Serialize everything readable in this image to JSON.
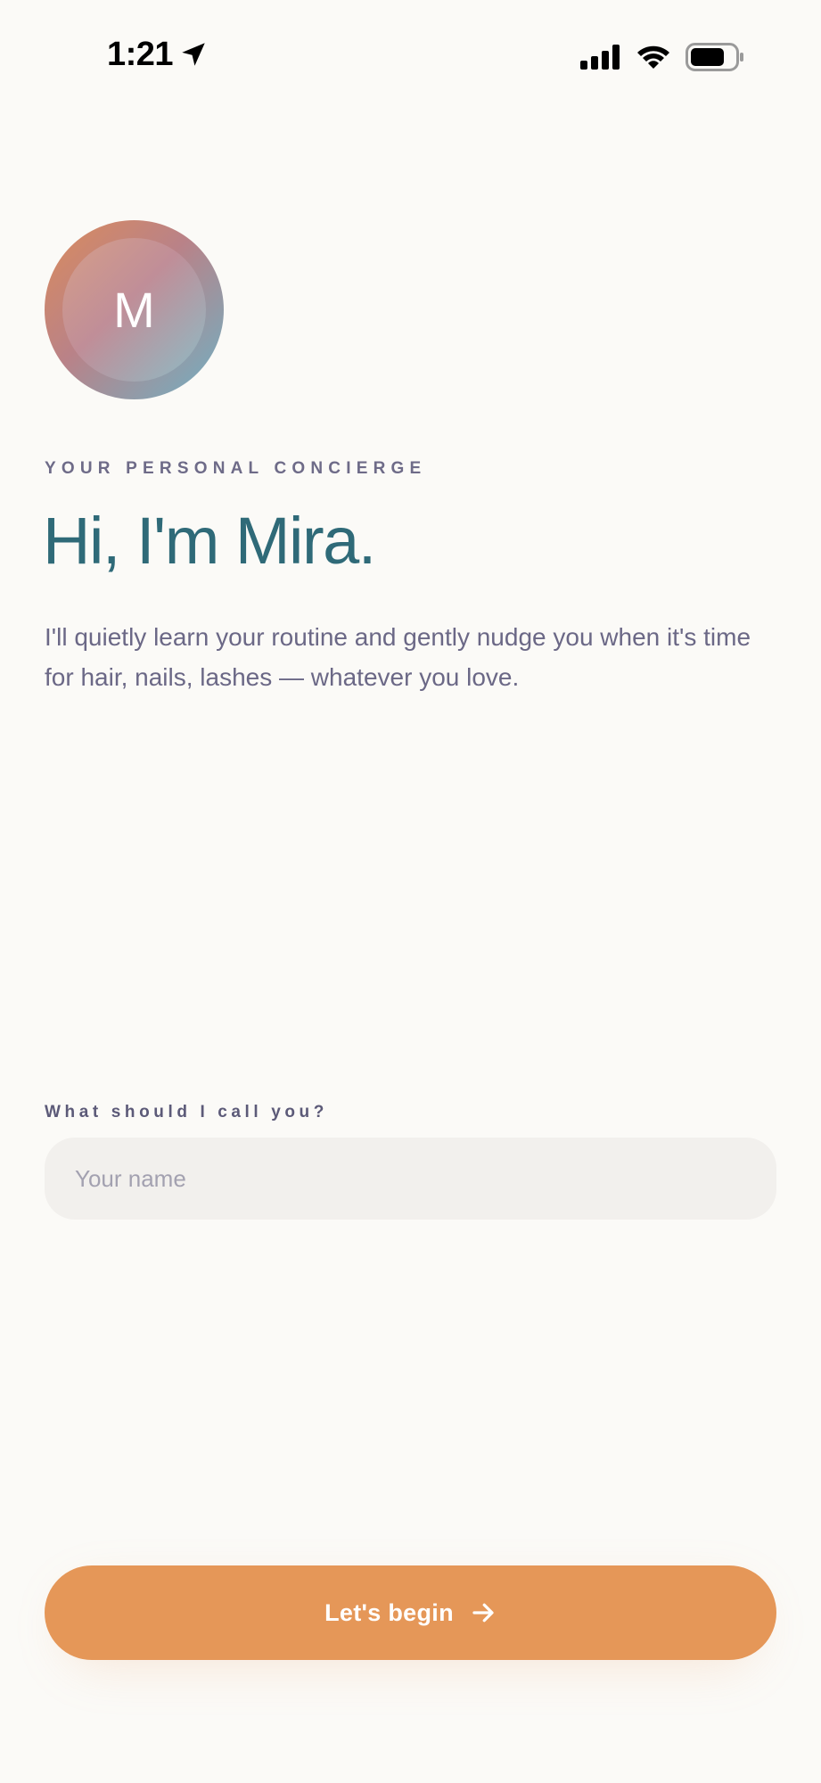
{
  "status_bar": {
    "time": "1:21",
    "icons": [
      "location-arrow-icon",
      "cellular-signal-icon",
      "wifi-icon",
      "battery-icon"
    ]
  },
  "avatar": {
    "initial": "M",
    "gradient_colors": [
      "#db8b5c",
      "#b98288",
      "#6fb1c4"
    ]
  },
  "intro": {
    "eyebrow": "YOUR PERSONAL CONCIERGE",
    "heading": "Hi, I'm Mira.",
    "body": "I'll quietly learn your routine and gently nudge you when it's time for hair, nails, lashes — whatever you love."
  },
  "name_field": {
    "label": "What should I call you?",
    "placeholder": "Your name",
    "value": ""
  },
  "cta": {
    "label": "Let's begin",
    "icon": "arrow-right-icon"
  },
  "colors": {
    "background": "#fbfaf7",
    "accent": "#e59758",
    "heading": "#2f6a78",
    "body_text": "#6b6886",
    "input_background": "#f2f0ed"
  }
}
